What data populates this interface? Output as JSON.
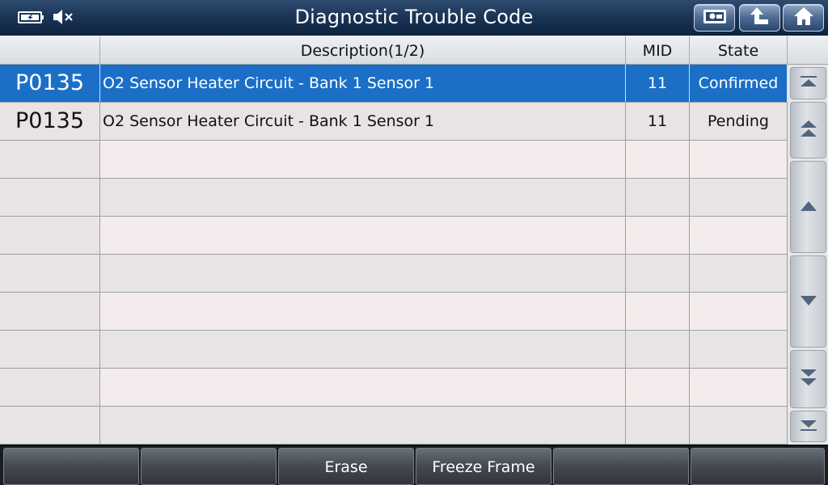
{
  "header": {
    "title": "Diagnostic Trouble Code",
    "status_icons": [
      "battery-charging-icon",
      "speaker-muted-icon"
    ],
    "buttons": [
      "screenshot-icon",
      "back-icon",
      "home-icon"
    ]
  },
  "table": {
    "columns": {
      "code": "",
      "description": "Description(1/2)",
      "mid": "MID",
      "state": "State"
    },
    "rows": [
      {
        "code": "P0135",
        "description": "O2 Sensor Heater Circuit - Bank 1 Sensor 1",
        "mid": "11",
        "state": "Confirmed"
      },
      {
        "code": "P0135",
        "description": "O2 Sensor Heater Circuit - Bank 1 Sensor 1",
        "mid": "11",
        "state": "Pending"
      },
      {
        "code": "",
        "description": "",
        "mid": "",
        "state": ""
      },
      {
        "code": "",
        "description": "",
        "mid": "",
        "state": ""
      },
      {
        "code": "",
        "description": "",
        "mid": "",
        "state": ""
      },
      {
        "code": "",
        "description": "",
        "mid": "",
        "state": ""
      },
      {
        "code": "",
        "description": "",
        "mid": "",
        "state": ""
      },
      {
        "code": "",
        "description": "",
        "mid": "",
        "state": ""
      },
      {
        "code": "",
        "description": "",
        "mid": "",
        "state": ""
      },
      {
        "code": "",
        "description": "",
        "mid": "",
        "state": ""
      }
    ]
  },
  "scroll": [
    "scroll-top-icon",
    "page-up-icon",
    "line-up-icon",
    "line-down-icon",
    "page-down-icon",
    "scroll-bottom-icon"
  ],
  "footer": {
    "buttons": [
      "",
      "",
      "Erase",
      "Freeze Frame",
      "",
      ""
    ]
  },
  "colors": {
    "title_bar": "#1c3658",
    "selected_row": "#1b6fc7",
    "row_light": "#f4ecec",
    "row_dark": "#e8e3e4",
    "bottom_bar": "#1a1d22"
  }
}
